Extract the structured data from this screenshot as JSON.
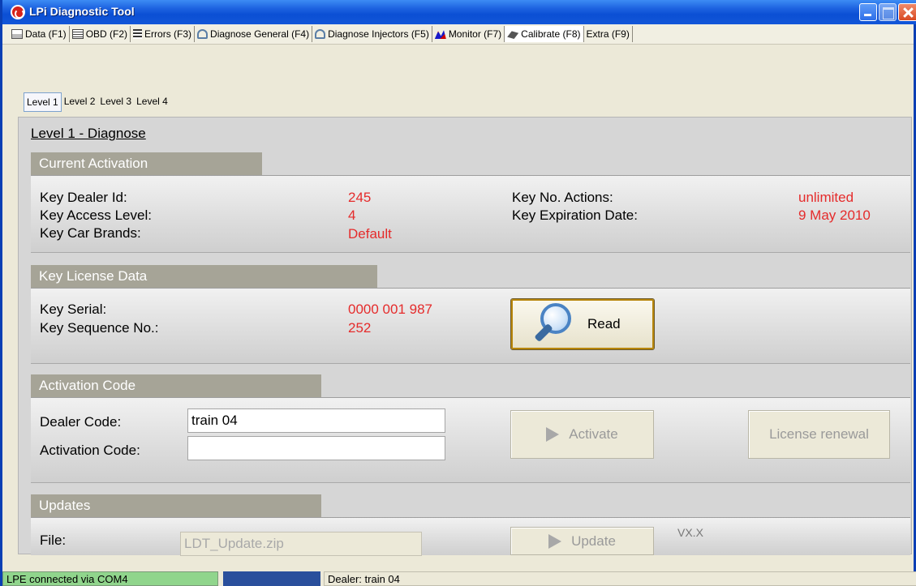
{
  "window": {
    "title": "LPi Diagnostic Tool"
  },
  "menu": {
    "items": [
      {
        "label": "Data (F1)",
        "icon": "data-icon"
      },
      {
        "label": "OBD (F2)",
        "icon": "obd-icon"
      },
      {
        "label": "Errors (F3)",
        "icon": "errors-icon"
      },
      {
        "label": "Diagnose General (F4)",
        "icon": "stethoscope-icon"
      },
      {
        "label": "Diagnose Injectors (F5)",
        "icon": "stethoscope-icon"
      },
      {
        "label": "Monitor (F7)",
        "icon": "monitor-chart-icon"
      },
      {
        "label": "Calibrate (F8)",
        "icon": "calibrate-icon"
      },
      {
        "label": "Extra (F9)",
        "icon": ""
      }
    ]
  },
  "levels": {
    "tabs": [
      "Level 1",
      "Level 2",
      "Level 3",
      "Level 4"
    ],
    "active": "Level 1"
  },
  "page": {
    "title": "Level 1 - Diagnose"
  },
  "current_activation": {
    "header": "Current Activation",
    "dealer_id_label": "Key Dealer Id:",
    "dealer_id": "245",
    "access_level_label": "Key Access Level:",
    "access_level": "4",
    "car_brands_label": "Key Car Brands:",
    "car_brands": "Default",
    "no_actions_label": "Key No. Actions:",
    "no_actions": "unlimited",
    "expiration_label": "Key Expiration Date:",
    "expiration": "9 May 2010"
  },
  "license": {
    "header": "Key License Data",
    "serial_label": "Key Serial:",
    "serial": "0000 001 987",
    "sequence_label": "Key Sequence No.:",
    "sequence": "252",
    "read_button": "Read"
  },
  "activation": {
    "header": "Activation Code",
    "dealer_code_label": "Dealer Code:",
    "dealer_code": "train 04",
    "activation_code_label": "Activation Code:",
    "activation_code": "",
    "activate_button": "Activate",
    "renewal_button": "License renewal"
  },
  "updates": {
    "header": "Updates",
    "file_label": "File:",
    "file_value": "LDT_Update.zip",
    "update_button": "Update",
    "version": "VX.X"
  },
  "status": {
    "connection": "LPE connected via COM4",
    "dealer": "Dealer: train 04"
  },
  "colors": {
    "value_red": "#e52b2b",
    "section_header": "#a6a497",
    "connected_green": "#90d58c"
  }
}
